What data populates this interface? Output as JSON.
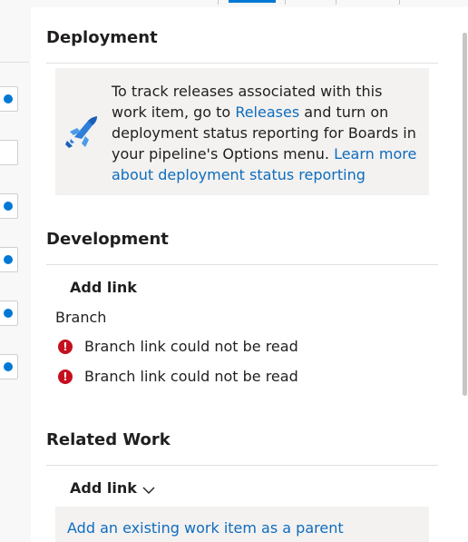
{
  "deployment": {
    "title": "Deployment",
    "info_pre": "To track releases associated with this work item, go to ",
    "releases_link": "Releases",
    "info_post": " and turn on deployment status reporting for Boards in your pipeline's Options menu. ",
    "learn_more_link": "Learn more about deployment status reporting",
    "icon": "pipelines-icon"
  },
  "development": {
    "title": "Development",
    "add_link": "Add link",
    "branch_label": "Branch",
    "errors": [
      {
        "icon": "error-icon",
        "glyph": "!",
        "text": "Branch link could not be read"
      },
      {
        "icon": "error-icon",
        "glyph": "!",
        "text": "Branch link could not be read"
      }
    ]
  },
  "related_work": {
    "title": "Related Work",
    "add_link": "Add link",
    "dropdown_icon": "chevron-down-icon",
    "parent_link": "Add an existing work item as a parent"
  },
  "colors": {
    "link": "#0f6cbd",
    "error": "#c50f1f",
    "accent": "#0078d4",
    "info_box": "#f3f2f1"
  }
}
